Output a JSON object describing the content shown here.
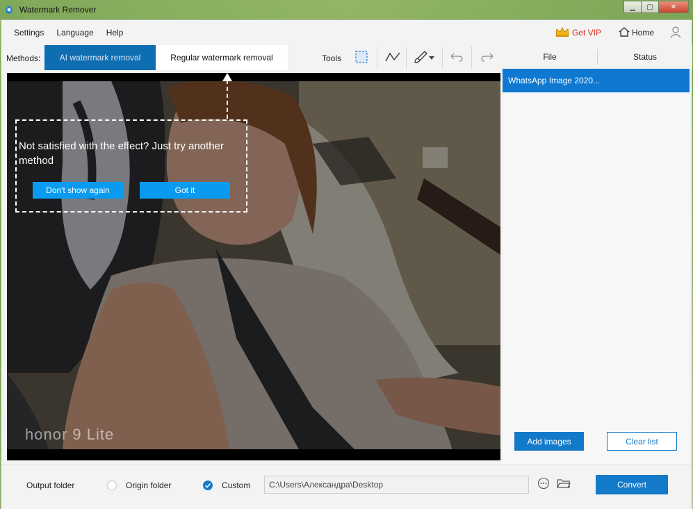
{
  "window": {
    "title": "Watermark Remover",
    "controls": {
      "minimize": "▁",
      "maximize": "▢",
      "close": "✕"
    }
  },
  "menu": {
    "settings": "Settings",
    "language": "Language",
    "help": "Help",
    "get_vip": "Get VIP",
    "home": "Home"
  },
  "methods": {
    "label": "Methods:",
    "ai": "AI watermark removal",
    "regular": "Regular watermark removal"
  },
  "tools": {
    "label": "Tools"
  },
  "list": {
    "col_file": "File",
    "col_status": "Status",
    "files": [
      {
        "name": "WhatsApp Image 2020..."
      }
    ],
    "add_images": "Add images",
    "clear_list": "Clear list"
  },
  "tip": {
    "message": "Not satisfied with the effect? Just try another method",
    "dont_show": "Don't show again",
    "got_it": "Got it"
  },
  "image": {
    "watermark_text": "honor 9 Lite"
  },
  "bottom": {
    "output_folder": "Output folder",
    "origin_folder": "Origin folder",
    "custom": "Custom",
    "path_value": "C:\\Users\\Александра\\Desktop",
    "convert": "Convert"
  },
  "colors": {
    "accent": "#1379c9",
    "tab_active": "#0f6db2",
    "tip_button": "#0a9bf0",
    "vip": "#d82a1a"
  }
}
